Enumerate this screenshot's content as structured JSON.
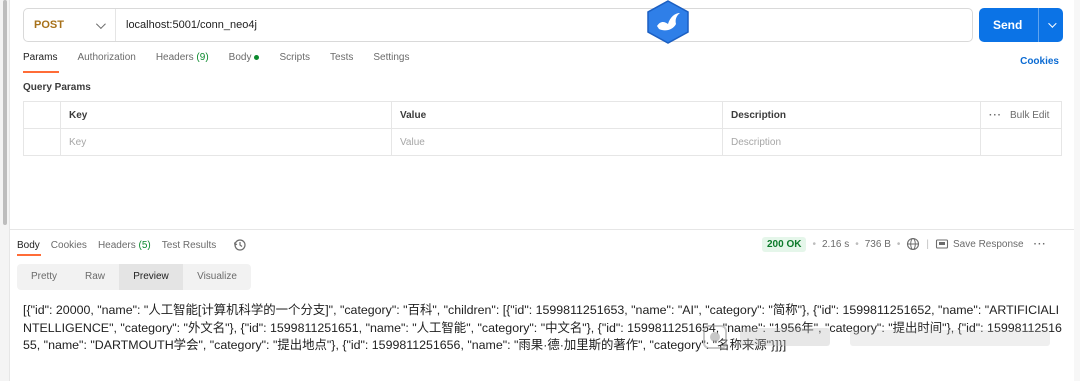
{
  "request": {
    "method": "POST",
    "url": "localhost:5001/conn_neo4j",
    "send_label": "Send"
  },
  "request_tabs": [
    {
      "label": "Params",
      "active": true
    },
    {
      "label": "Authorization"
    },
    {
      "label": "Headers",
      "count": "(9)"
    },
    {
      "label": "Body",
      "dot": true
    },
    {
      "label": "Scripts"
    },
    {
      "label": "Tests"
    },
    {
      "label": "Settings"
    }
  ],
  "cookies_label": "Cookies",
  "query_params": {
    "title": "Query Params",
    "headers": {
      "key": "Key",
      "value": "Value",
      "description": "Description",
      "bulk_edit": "Bulk Edit"
    },
    "placeholders": {
      "key": "Key",
      "value": "Value",
      "description": "Description"
    }
  },
  "response_tabs": [
    {
      "label": "Body",
      "active": true
    },
    {
      "label": "Cookies"
    },
    {
      "label": "Headers",
      "count": "(5)"
    },
    {
      "label": "Test Results"
    }
  ],
  "response_meta": {
    "status": "200 OK",
    "time": "2.16 s",
    "size": "736 B",
    "save_label": "Save Response"
  },
  "view_modes": [
    {
      "label": "Pretty"
    },
    {
      "label": "Raw"
    },
    {
      "label": "Preview",
      "active": true
    },
    {
      "label": "Visualize"
    }
  ],
  "response_body": "[{\"id\": 20000, \"name\": \"人工智能[计算机科学的一个分支]\", \"category\": \"百科\", \"children\": [{\"id\": 1599811251653, \"name\": \"AI\", \"category\": \"简称\"}, {\"id\": 1599811251652, \"name\": \"ARTIFICIALINTELLIGENCE\", \"category\": \"外文名\"}, {\"id\": 1599811251651, \"name\": \"人工智能\", \"category\": \"中文名\"}, {\"id\": 1599811251654, \"name\": \"1956年\", \"category\": \"提出时间\"}, {\"id\": 1599811251655, \"name\": \"DARTMOUTH学会\", \"category\": \"提出地点\"}, {\"id\": 1599811251656, \"name\": \"雨果·德·加里斯的著作\", \"category\": \"名称来源\"}]}]",
  "colors": {
    "send": "#0b73e6",
    "method": "#a7711a",
    "active_tab_underline": "#ff6c37",
    "status_ok": "#0c7a2a",
    "link": "#0b6bd3"
  }
}
